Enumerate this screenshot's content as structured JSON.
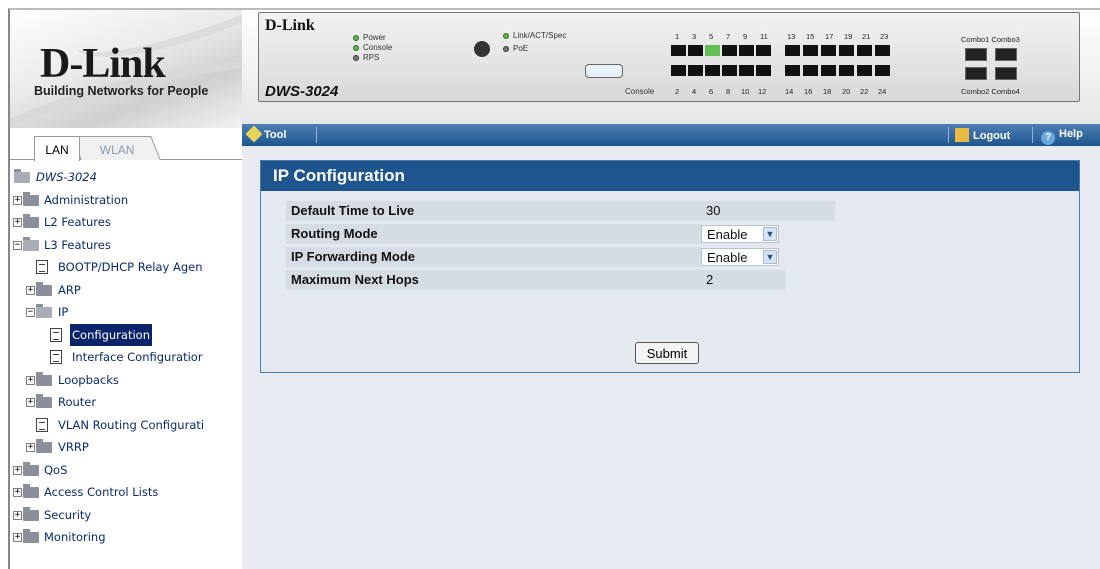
{
  "logo": {
    "brand": "D-Link",
    "tagline": "Building Networks for People"
  },
  "tabs": [
    {
      "label": "LAN",
      "active": true
    },
    {
      "label": "WLAN",
      "active": false
    }
  ],
  "tree": {
    "root": "DWS-3024",
    "items": [
      {
        "label": "Administration"
      },
      {
        "label": "L2 Features"
      },
      {
        "label": "L3 Features"
      },
      {
        "label": "BOOTP/DHCP Relay Agen"
      },
      {
        "label": "ARP"
      },
      {
        "label": "IP"
      },
      {
        "label": "Configuration",
        "selected": true
      },
      {
        "label": "Interface Configuratior"
      },
      {
        "label": "Loopbacks"
      },
      {
        "label": "Router"
      },
      {
        "label": "VLAN Routing Configurati"
      },
      {
        "label": "VRRP"
      },
      {
        "label": "QoS"
      },
      {
        "label": "Access Control Lists"
      },
      {
        "label": "Security"
      },
      {
        "label": "Monitoring"
      }
    ]
  },
  "device": {
    "logo": "D-Link",
    "model": "DWS-3024",
    "leds": {
      "power": "Power",
      "console": "Console",
      "rps": "RPS",
      "link": "Link/ACT/Spec",
      "poe": "PoE"
    },
    "console_label": "Console",
    "ports_top": [
      "1",
      "3",
      "5",
      "7",
      "9",
      "11",
      "13",
      "15",
      "17",
      "19",
      "21",
      "23"
    ],
    "ports_bottom": [
      "2",
      "4",
      "6",
      "8",
      "10",
      "12",
      "14",
      "16",
      "18",
      "20",
      "22",
      "24"
    ],
    "combo_top": "Combo1 Combo3",
    "combo_bottom": "Combo2 Combo4"
  },
  "toolbar": {
    "tool": "Tool",
    "logout": "Logout",
    "help": "Help"
  },
  "panel": {
    "title": "IP Configuration",
    "rows": [
      {
        "label": "Default Time to Live",
        "value": "30"
      },
      {
        "label": "Routing Mode",
        "value": "Enable"
      },
      {
        "label": "IP Forwarding Mode",
        "value": "Enable"
      },
      {
        "label": "Maximum Next Hops",
        "value": "2"
      }
    ],
    "submit": "Submit"
  },
  "colors": {
    "accent": "#1f558e",
    "tree_text": "#0b2a6e",
    "selected_bg": "#0a246a"
  }
}
